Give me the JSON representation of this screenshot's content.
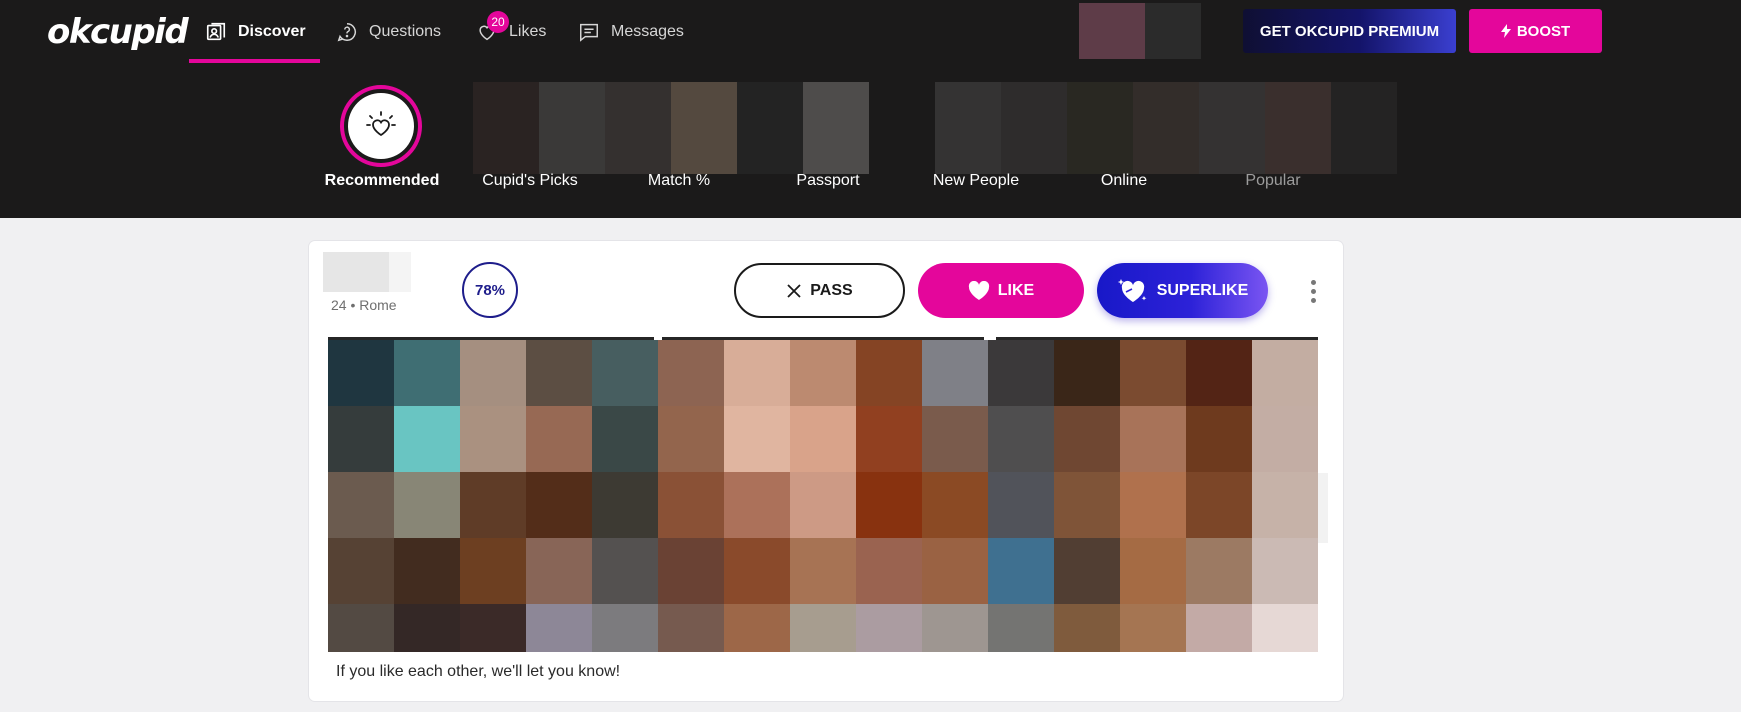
{
  "app": {
    "logo": "okcupid"
  },
  "nav": {
    "items": [
      {
        "label": "Discover",
        "icon": "discover-icon",
        "active": true
      },
      {
        "label": "Questions",
        "icon": "questions-icon",
        "active": false
      },
      {
        "label": "Likes",
        "icon": "likes-icon",
        "active": false,
        "badge": "20"
      },
      {
        "label": "Messages",
        "icon": "messages-icon",
        "active": false
      }
    ],
    "premium_label": "GET OKCUPID PREMIUM",
    "boost_label": "BOOST"
  },
  "discover": {
    "categories": [
      {
        "label": "Recommended",
        "active": true
      },
      {
        "label": "Cupid's Picks"
      },
      {
        "label": "Match %"
      },
      {
        "label": "Passport"
      },
      {
        "label": "New People"
      },
      {
        "label": "Online"
      },
      {
        "label": "Popular",
        "dimmed": true
      }
    ]
  },
  "profile": {
    "meta": "24 • Rome",
    "match": "78%",
    "pass_label": "PASS",
    "like_label": "LIKE",
    "superlike_label": "SUPERLIKE",
    "footer_note": "If you like each other, we'll let you know!"
  },
  "colors": {
    "accent": "#e4069b",
    "dark_bg": "#1b1a1a",
    "match_ring": "#1e1d8b",
    "superlike_start": "#1818c8",
    "superlike_end": "#7a55f2"
  }
}
